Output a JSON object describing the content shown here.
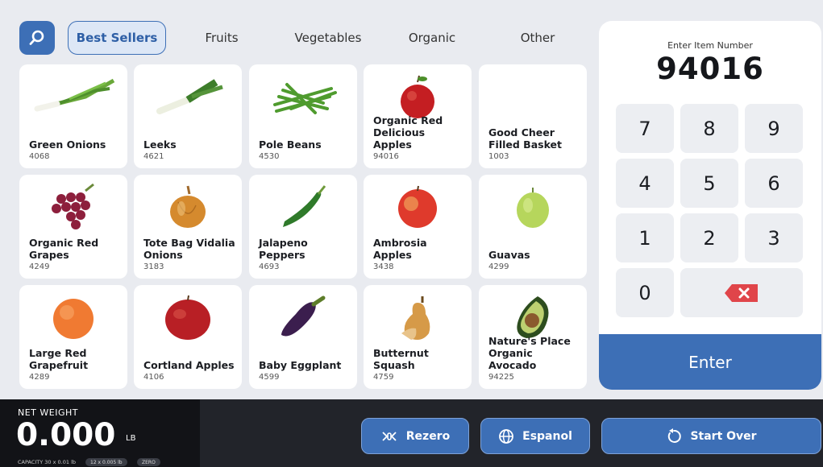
{
  "tabs": [
    {
      "label": "Best Sellers",
      "active": true
    },
    {
      "label": "Fruits",
      "active": false
    },
    {
      "label": "Vegetables",
      "active": false
    },
    {
      "label": "Organic",
      "active": false
    },
    {
      "label": "Other",
      "active": false
    }
  ],
  "products": [
    {
      "name": "Green Onions",
      "code": "4068",
      "icon": "green-onions-image"
    },
    {
      "name": "Leeks",
      "code": "4621",
      "icon": "leeks-image"
    },
    {
      "name": "Pole Beans",
      "code": "4530",
      "icon": "pole-beans-image"
    },
    {
      "name": "Organic Red Delicious Apples",
      "code": "94016",
      "icon": "red-apple-image"
    },
    {
      "name": "Good Cheer Filled Basket",
      "code": "1003",
      "icon": "none"
    },
    {
      "name": "Organic Red Grapes",
      "code": "4249",
      "icon": "red-grapes-image"
    },
    {
      "name": "Tote Bag Vidalia Onions",
      "code": "3183",
      "icon": "onion-image"
    },
    {
      "name": "Jalapeno Peppers",
      "code": "4693",
      "icon": "jalapeno-image"
    },
    {
      "name": "Ambrosia Apples",
      "code": "3438",
      "icon": "ambrosia-apple-image"
    },
    {
      "name": "Guavas",
      "code": "4299",
      "icon": "guava-image"
    },
    {
      "name": "Large Red Grapefruit",
      "code": "4289",
      "icon": "grapefruit-image"
    },
    {
      "name": "Cortland Apples",
      "code": "4106",
      "icon": "cortland-apple-image"
    },
    {
      "name": "Baby Eggplant",
      "code": "4599",
      "icon": "eggplant-image"
    },
    {
      "name": "Butternut Squash",
      "code": "4759",
      "icon": "butternut-squash-image"
    },
    {
      "name": "Nature's Place Organic Avocado",
      "code": "94225",
      "icon": "avocado-image"
    }
  ],
  "keypad": {
    "label": "Enter Item Number",
    "value": "94016",
    "keys": [
      "7",
      "8",
      "9",
      "4",
      "5",
      "6",
      "1",
      "2",
      "3",
      "0"
    ],
    "enter_label": "Enter"
  },
  "scale": {
    "net_weight_label": "NET WEIGHT",
    "weight": "0.000",
    "unit": "LB",
    "capacity": "CAPACITY 30 x 0.01 lb",
    "pill_1": "12 x 0.005 lb",
    "pill_2": "ZERO"
  },
  "actions": {
    "rezero": "Rezero",
    "espanol": "Espanol",
    "start_over": "Start Over"
  },
  "colors": {
    "accent": "#3d6fb6",
    "delete": "#e0454a",
    "bottom_bar": "#22242a"
  }
}
